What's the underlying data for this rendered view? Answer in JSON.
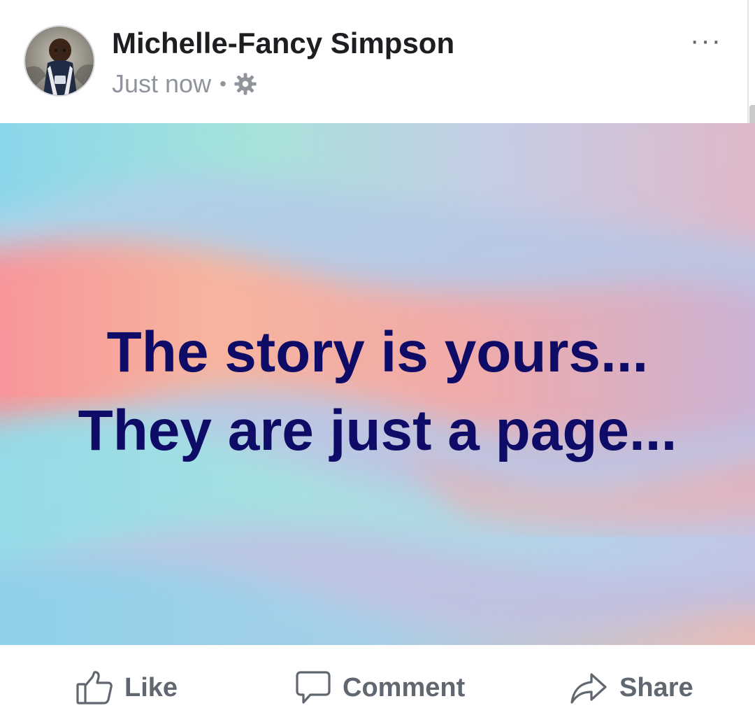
{
  "post": {
    "author_name": "Michelle-Fancy Simpson",
    "timestamp": "Just now",
    "separator": "•",
    "audience_icon": "gear-icon",
    "more_label": "···",
    "text_lines": [
      "The story is yours...",
      "They are just a page..."
    ],
    "text_color": "#0e0c66"
  },
  "actions": {
    "like_label": "Like",
    "comment_label": "Comment",
    "share_label": "Share",
    "icon_color": "#606770"
  }
}
